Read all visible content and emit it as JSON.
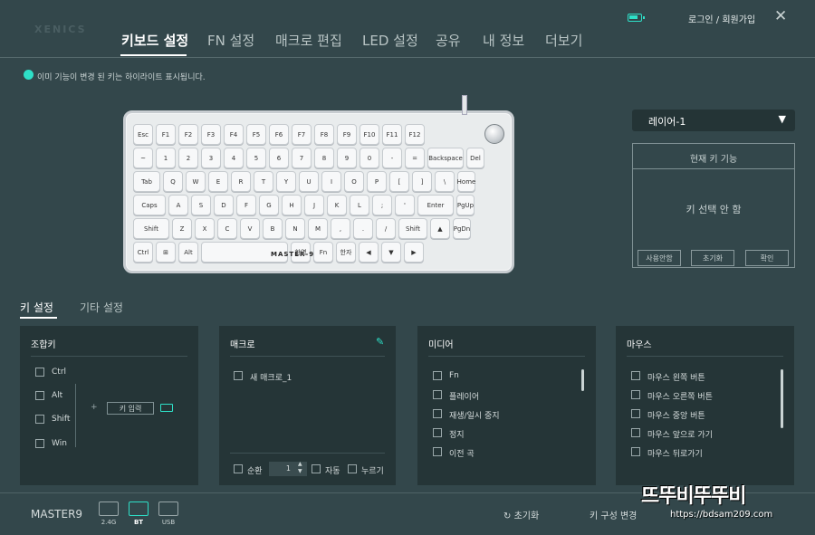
{
  "logo": "XENICS",
  "tabs": [
    "키보드 설정",
    "FN 설정",
    "매크로 편집",
    "LED 설정",
    "공유",
    "내 정보",
    "더보기"
  ],
  "login": "로그인 / 회원가입",
  "hint": "이미 기능이 변경 된 키는 하이라이트 표시됩니다.",
  "keyboard": {
    "brand": "MASTER-9",
    "rows": [
      [
        "Esc",
        "F1",
        "F2",
        "F3",
        "F4",
        "F5",
        "F6",
        "F7",
        "F8",
        "F9",
        "F10",
        "F11",
        "F12"
      ],
      [
        "~",
        "1",
        "2",
        "3",
        "4",
        "5",
        "6",
        "7",
        "8",
        "9",
        "0",
        "-",
        "=",
        "Backspace",
        "Del"
      ],
      [
        "Tab",
        "Q",
        "W",
        "E",
        "R",
        "T",
        "Y",
        "U",
        "I",
        "O",
        "P",
        "[",
        "]",
        "\\",
        "Home"
      ],
      [
        "Caps",
        "A",
        "S",
        "D",
        "F",
        "G",
        "H",
        "J",
        "K",
        "L",
        ";",
        "'",
        "Enter",
        "PgUp"
      ],
      [
        "Shift",
        "Z",
        "X",
        "C",
        "V",
        "B",
        "N",
        "M",
        ",",
        ".",
        "/",
        "Shift",
        "▲",
        "PgDn"
      ],
      [
        "Ctrl",
        "⊞",
        "Alt",
        "",
        "한영",
        "Fn",
        "한자",
        "◀",
        "▼",
        "▶"
      ]
    ]
  },
  "layer": {
    "selected": "레이어-1"
  },
  "current": {
    "title": "현재 키 기능",
    "value": "키 선택 안 함",
    "btn_disable": "사용안함",
    "btn_reset": "초기화",
    "btn_ok": "확인"
  },
  "subtabs": [
    "키 설정",
    "기타 설정"
  ],
  "combo": {
    "title": "조합키",
    "items": [
      "Ctrl",
      "Alt",
      "Shift",
      "Win"
    ],
    "plus": "+",
    "key_input": "키 입력"
  },
  "macro": {
    "title": "매크로",
    "items": [
      "새 매크로_1"
    ],
    "loop": "순환",
    "count": "1",
    "auto": "자동",
    "press": "누르기"
  },
  "media": {
    "title": "미디어",
    "items": [
      "Fn",
      "플레이어",
      "재생/일시 중지",
      "정지",
      "이전 곡"
    ]
  },
  "mouse": {
    "title": "마우스",
    "items": [
      "마우스 왼쪽 버튼",
      "마우스 오른쪽 버튼",
      "마우스 중앙 버튼",
      "마우스 앞으로 가기",
      "마우스 뒤로가기"
    ]
  },
  "footer": {
    "device": "MASTER9",
    "modes": [
      "2.4G",
      "BT",
      "USB"
    ],
    "reset": "초기화",
    "config": "키 구성 변경",
    "watermark": "뜨뚜비뚜뚜비",
    "url": "https://bdsam209.com"
  },
  "colors": {
    "bg": "#33474b",
    "panel": "#253537",
    "accent": "#2ee0c8"
  }
}
